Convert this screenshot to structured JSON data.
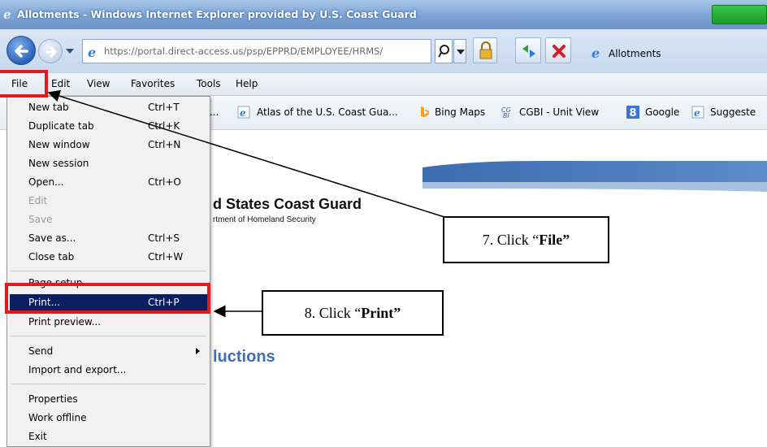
{
  "window": {
    "title": "Allotments - Windows Internet Explorer provided by U.S. Coast Guard"
  },
  "address_bar": {
    "url": "https://portal.direct-access.us/psp/EPPRD/EMPLOYEE/HRMS/"
  },
  "tab": {
    "label": "Allotments"
  },
  "menubar": {
    "items": [
      "File",
      "Edit",
      "View",
      "Favorites",
      "Tools",
      "Help"
    ]
  },
  "favorites": {
    "items": [
      "...",
      "Atlas of the U.S. Coast Gua...",
      "Bing Maps",
      "CGBI - Unit View",
      "Google",
      "Suggeste"
    ]
  },
  "page": {
    "org_name": "d States Coast Guard",
    "org_sub": "rtment of Homeland Security",
    "section_title": "luctions"
  },
  "file_menu": {
    "items": [
      {
        "label": "New tab",
        "shortcut": "Ctrl+T"
      },
      {
        "label": "Duplicate tab",
        "shortcut": "Ctrl+K"
      },
      {
        "label": "New window",
        "shortcut": "Ctrl+N"
      },
      {
        "label": "New session",
        "shortcut": ""
      },
      {
        "label": "Open...",
        "shortcut": "Ctrl+O"
      },
      {
        "label": "Edit",
        "shortcut": ""
      },
      {
        "label": "Save",
        "shortcut": ""
      },
      {
        "label": "Save as...",
        "shortcut": "Ctrl+S"
      },
      {
        "label": "Close tab",
        "shortcut": "Ctrl+W"
      },
      {
        "label": "Page setup...",
        "shortcut": ""
      },
      {
        "label": "Print...",
        "shortcut": "Ctrl+P"
      },
      {
        "label": "Print preview...",
        "shortcut": ""
      },
      {
        "label": "Send",
        "shortcut": ""
      },
      {
        "label": "Import and export...",
        "shortcut": ""
      },
      {
        "label": "Properties",
        "shortcut": ""
      },
      {
        "label": "Work offline",
        "shortcut": ""
      },
      {
        "label": "Exit",
        "shortcut": ""
      }
    ]
  },
  "callouts": {
    "file": {
      "prefix": "7. Click “",
      "bold": "File”"
    },
    "print": {
      "prefix": "8. Click “",
      "bold": "Print”"
    }
  },
  "colors": {
    "title_bar": "#7fa6d6",
    "highlight_red": "#e01b1b",
    "menu_selection": "#0c1e60",
    "section_title": "#3d6fb5"
  }
}
